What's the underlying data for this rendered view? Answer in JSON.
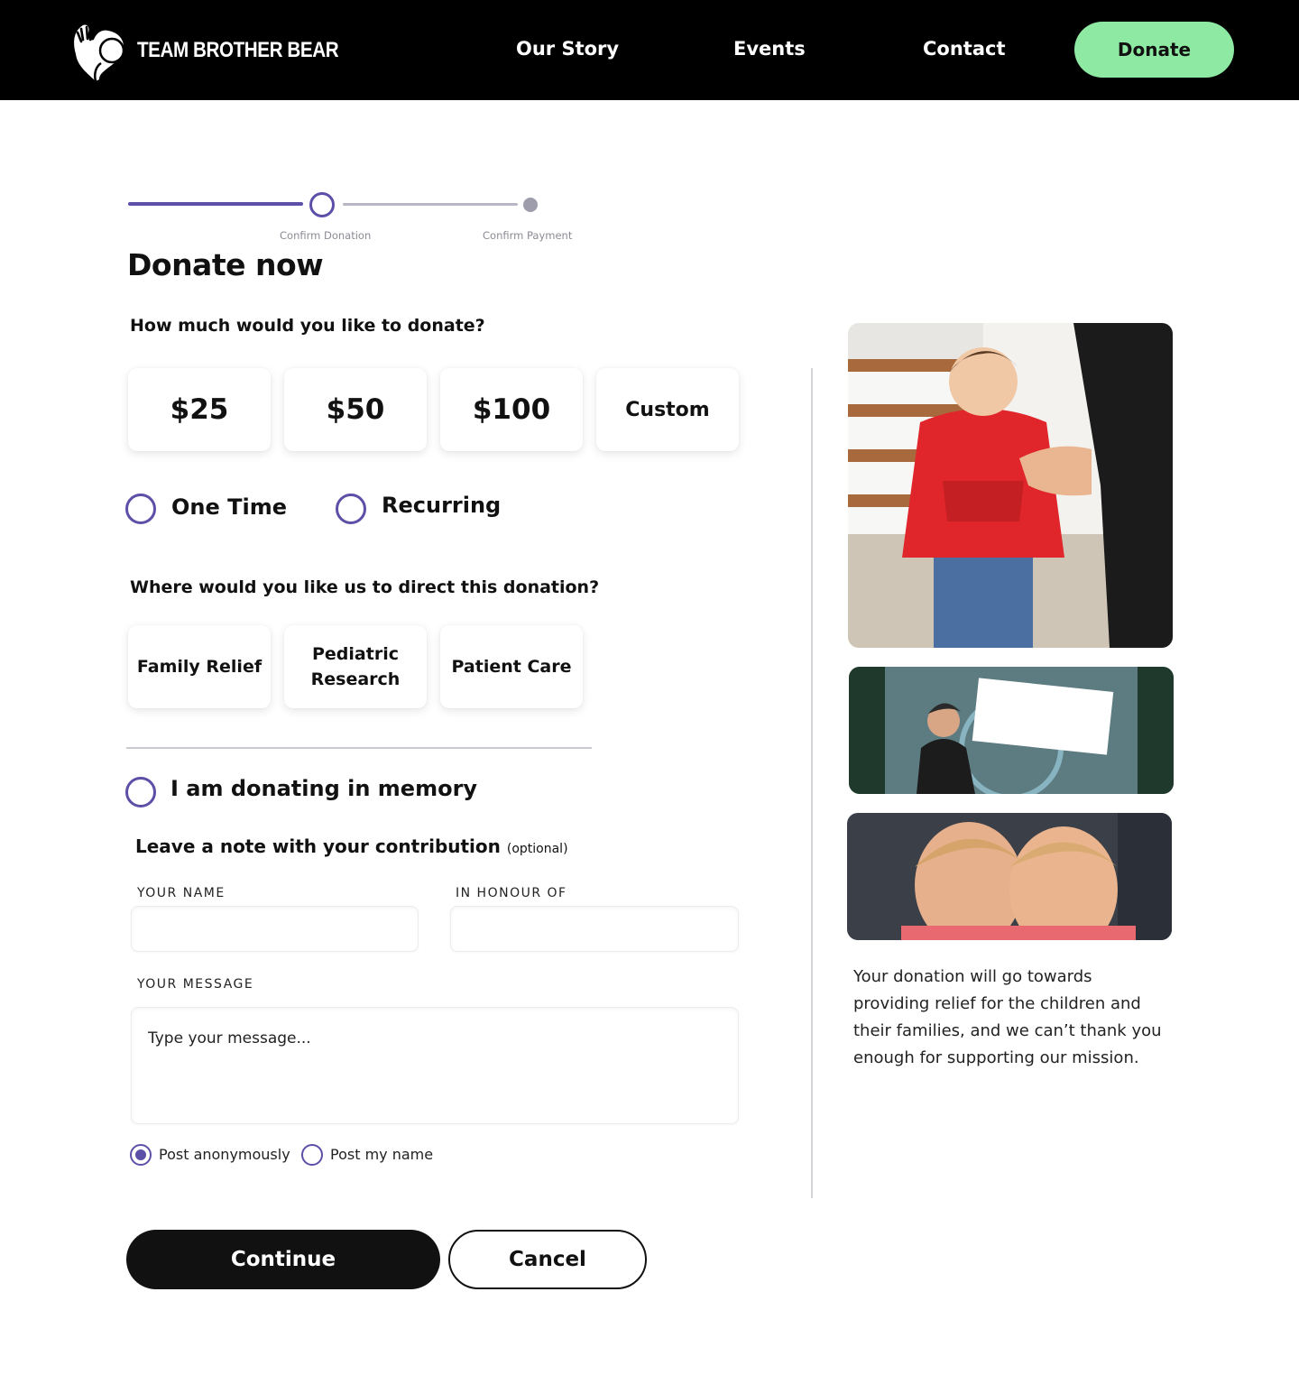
{
  "nav": {
    "brand": "TEAM BROTHER BEAR",
    "links": [
      "Our Story",
      "Events",
      "Contact"
    ],
    "donate_label": "Donate"
  },
  "progress": {
    "steps": [
      "Confirm Donation",
      "Confirm Payment"
    ],
    "current_step": 1
  },
  "title": "Donate now",
  "amount": {
    "question": "How much would you like to donate?",
    "options": [
      "$25",
      "$50",
      "$100",
      "Custom"
    ]
  },
  "frequency": {
    "options": [
      "One Time",
      "Recurring"
    ]
  },
  "direction": {
    "question": "Where would you like us to direct this donation?",
    "options": [
      "Family Relief",
      "Pediatric Research",
      "Patient Care"
    ]
  },
  "memory": {
    "label": "I am donating in memory"
  },
  "note": {
    "title": "Leave a note with your contribution",
    "optional": "(optional)",
    "name_label": "YOUR NAME",
    "name_value": "",
    "honour_label": "IN HONOUR OF",
    "honour_value": "",
    "message_label": "YOUR MESSAGE",
    "message_placeholder": "Type your message..."
  },
  "posting": {
    "options": [
      "Post anonymously",
      "Post my name"
    ],
    "selected": "Post anonymously"
  },
  "actions": {
    "continue_label": "Continue",
    "cancel_label": "Cancel"
  },
  "sidebar": {
    "text": "Your donation will go towards providing relief for the children and their families, and we can’t thank you enough for supporting our mission."
  },
  "colors": {
    "accent": "#5b4fa8",
    "donate_button": "#8ee9a3",
    "nav_background": "#000000"
  }
}
